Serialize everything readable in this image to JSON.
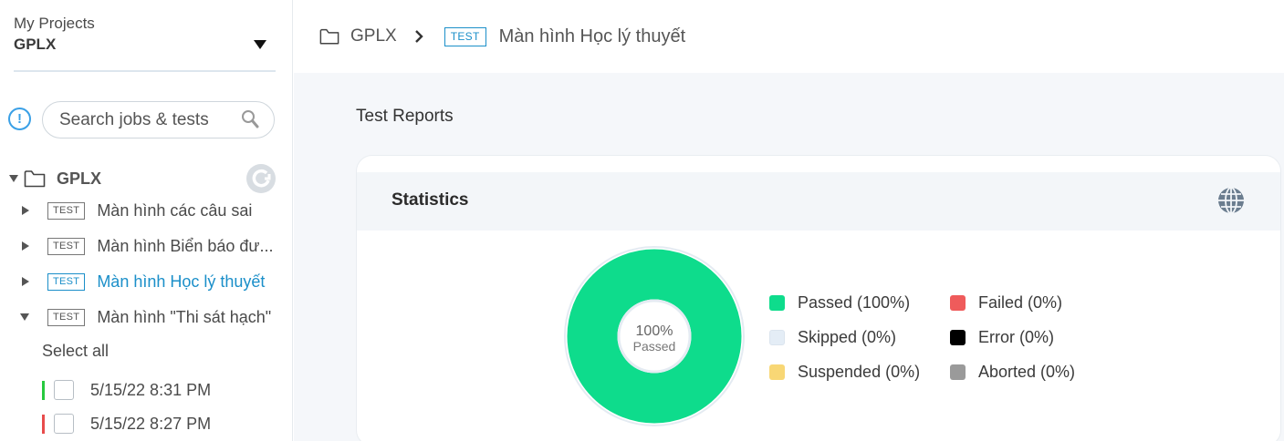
{
  "sidebar": {
    "project_label": "My Projects",
    "project_name": "GPLX",
    "search_placeholder": "Search jobs & tests",
    "info_glyph": "!",
    "tree": {
      "root_label": "GPLX",
      "items": [
        {
          "badge": "TEST",
          "label": "Màn hình các câu sai"
        },
        {
          "badge": "TEST",
          "label": "Màn hình Biển báo đư..."
        },
        {
          "badge": "TEST",
          "label": "Màn hình Học lý thuyết"
        },
        {
          "badge": "TEST",
          "label": "Màn hình \"Thi sát hạch\""
        }
      ],
      "select_all": "Select all",
      "runs": [
        {
          "label": "5/15/22 8:31 PM",
          "status_color": "#27c93f"
        },
        {
          "label": "5/15/22 8:27 PM",
          "status_color": "#e84c4c"
        }
      ]
    }
  },
  "breadcrumb": {
    "project": "GPLX",
    "separator": ">",
    "badge": "TEST",
    "current": "Màn hình Học lý thuyết"
  },
  "main": {
    "section_title": "Test Reports",
    "card_title": "Statistics",
    "donut": {
      "center_value": "100%",
      "center_label": "Passed"
    },
    "legend": [
      {
        "label": "Passed (100%)",
        "color": "#0edc8c"
      },
      {
        "label": "Skipped (0%)",
        "color": "#e4edf6"
      },
      {
        "label": "Suspended (0%)",
        "color": "#f8d775"
      },
      {
        "label": "Failed (0%)",
        "color": "#ef5b5b"
      },
      {
        "label": "Error (0%)",
        "color": "#000000"
      },
      {
        "label": "Aborted (0%)",
        "color": "#9a9a9a"
      }
    ]
  },
  "chart_data": {
    "type": "pie",
    "categories": [
      "Passed",
      "Skipped",
      "Suspended",
      "Failed",
      "Error",
      "Aborted"
    ],
    "values": [
      100,
      0,
      0,
      0,
      0,
      0
    ]
  },
  "colors": {
    "accent": "#1b8fc9",
    "passed": "#0edc8c"
  }
}
